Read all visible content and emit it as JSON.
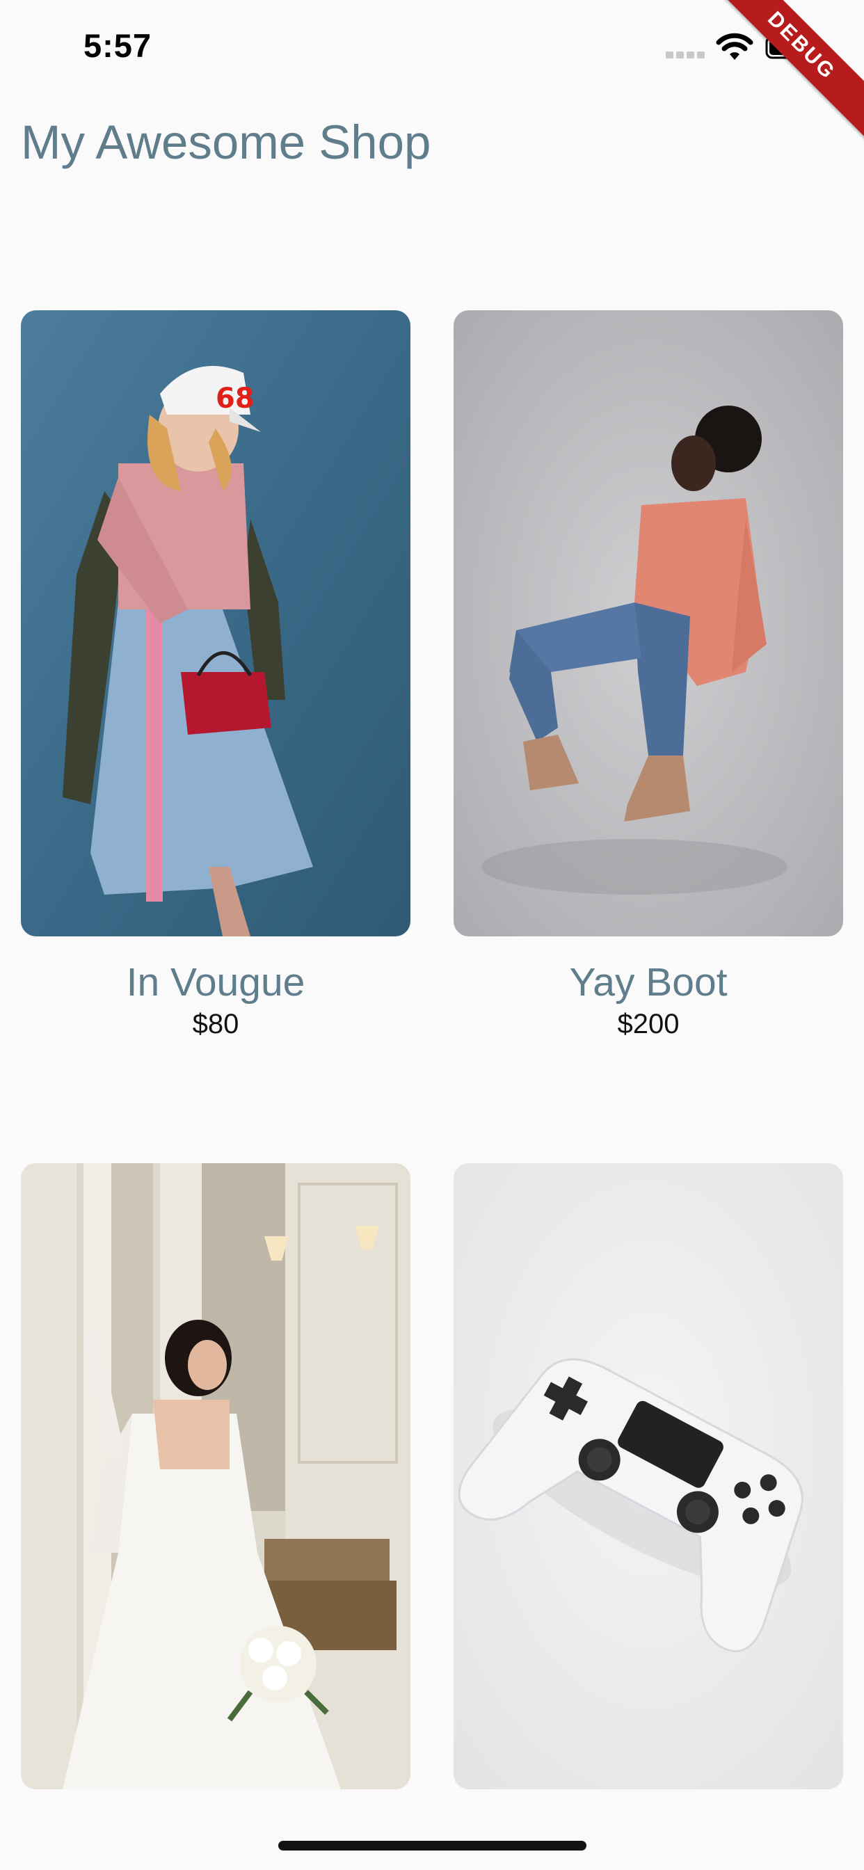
{
  "status_bar": {
    "time": "5:57"
  },
  "debug_banner": {
    "label": "DEBUG"
  },
  "app": {
    "title": "My Awesome Shop"
  },
  "products": [
    {
      "name": "In Vougue",
      "price": "$80",
      "image_icon": "woman-in-pink-sweater-and-denim-skirt-photo"
    },
    {
      "name": "Yay Boot",
      "price": "$200",
      "image_icon": "woman-in-jeans-and-boots-photo"
    },
    {
      "name": "",
      "price": "",
      "image_icon": "bride-in-white-wedding-dress-photo"
    },
    {
      "name": "",
      "price": "",
      "image_icon": "white-game-controller-photo"
    }
  ],
  "colors": {
    "title": "#607d8b",
    "background": "#fafafa",
    "debug_banner": "#b71c1c"
  }
}
